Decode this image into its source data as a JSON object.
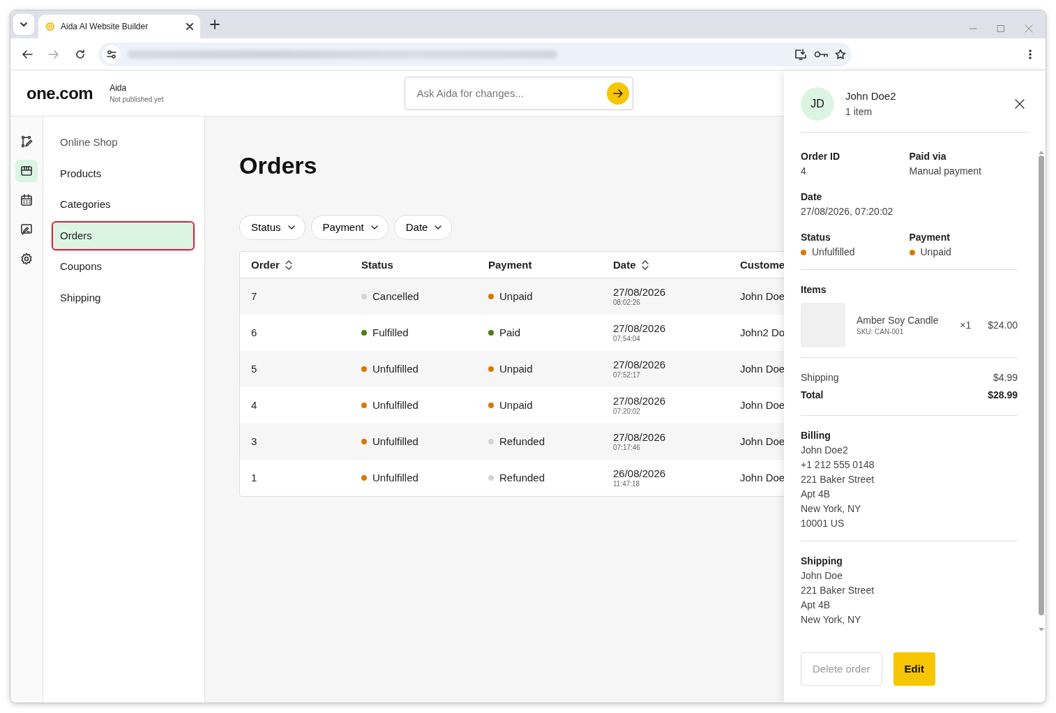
{
  "browser": {
    "tab_title": "Aida AI Website Builder"
  },
  "app": {
    "logo": "one.com",
    "site_name": "Aida",
    "site_status": "Not published yet",
    "ask_placeholder": "Ask Aida for changes..."
  },
  "rail": [
    {
      "selected": false
    },
    {
      "selected": true
    },
    {
      "selected": false
    },
    {
      "selected": false
    },
    {
      "selected": false
    }
  ],
  "sidebar": {
    "heading": "Online Shop",
    "items": [
      {
        "label": "Products",
        "selected": false
      },
      {
        "label": "Categories",
        "selected": false
      },
      {
        "label": "Orders",
        "selected": true
      },
      {
        "label": "Coupons",
        "selected": false
      },
      {
        "label": "Shipping",
        "selected": false
      }
    ]
  },
  "page_title": "Orders",
  "filters": [
    "Status",
    "Payment",
    "Date"
  ],
  "table": {
    "columns": [
      {
        "label": "Order",
        "sortable": true
      },
      {
        "label": "Status",
        "sortable": false
      },
      {
        "label": "Payment",
        "sortable": false
      },
      {
        "label": "Date",
        "sortable": true
      },
      {
        "label": "Custome",
        "sortable": false
      }
    ],
    "rows": [
      {
        "order": "7",
        "status": {
          "text": "Cancelled",
          "color": "#d4d4d4"
        },
        "payment": {
          "text": "Unpaid",
          "color": "#d97706"
        },
        "date": "27/08/2026",
        "time": "08:02:26",
        "customer": "John Doe"
      },
      {
        "order": "6",
        "status": {
          "text": "Fulfilled",
          "color": "#4d7c0f"
        },
        "payment": {
          "text": "Paid",
          "color": "#4d7c0f"
        },
        "date": "27/08/2026",
        "time": "07:54:04",
        "customer": "John2 Do"
      },
      {
        "order": "5",
        "status": {
          "text": "Unfulfilled",
          "color": "#d97706"
        },
        "payment": {
          "text": "Unpaid",
          "color": "#d97706"
        },
        "date": "27/08/2026",
        "time": "07:52:17",
        "customer": "John Doe"
      },
      {
        "order": "4",
        "status": {
          "text": "Unfulfilled",
          "color": "#d97706"
        },
        "payment": {
          "text": "Unpaid",
          "color": "#d97706"
        },
        "date": "27/08/2026",
        "time": "07:20:02",
        "customer": "John Doe"
      },
      {
        "order": "3",
        "status": {
          "text": "Unfulfilled",
          "color": "#d97706"
        },
        "payment": {
          "text": "Refunded",
          "color": "#d4d4d4"
        },
        "date": "27/08/2026",
        "time": "07:17:46",
        "customer": "John Doe"
      },
      {
        "order": "1",
        "status": {
          "text": "Unfulfilled",
          "color": "#d97706"
        },
        "payment": {
          "text": "Refunded",
          "color": "#d4d4d4"
        },
        "date": "26/08/2026",
        "time": "11:47:18",
        "customer": "John Doe"
      }
    ]
  },
  "drawer": {
    "avatar": "JD",
    "customer": "John Doe2",
    "item_count": "1 item",
    "fields": [
      {
        "label": "Order ID",
        "value": "4",
        "wide": false
      },
      {
        "label": "Paid via",
        "value": "Manual payment",
        "wide": false
      },
      {
        "label": "Date",
        "value": "27/08/2026, 07:20:02",
        "wide": true
      }
    ],
    "states": [
      {
        "label": "Status",
        "value": "Unfulfilled",
        "color": "#d97706"
      },
      {
        "label": "Payment",
        "value": "Unpaid",
        "color": "#d97706"
      }
    ],
    "items_title": "Items",
    "items": [
      {
        "name": "Amber Soy Candle",
        "sku": "SKU: CAN-001",
        "qty": "×1",
        "price": "$24.00"
      }
    ],
    "totals": [
      {
        "label": "Shipping",
        "value": "$4.99",
        "strong": false
      },
      {
        "label": "Total",
        "value": "$28.99",
        "strong": true
      }
    ],
    "addresses": [
      {
        "title": "Billing",
        "lines": [
          "John Doe2",
          "+1 212 555 0148",
          "221 Baker Street",
          "Apt 4B",
          "New York, NY",
          "10001 US"
        ]
      },
      {
        "title": "Shipping",
        "lines": [
          "John Doe",
          "221 Baker Street",
          "Apt 4B",
          "New York, NY"
        ]
      }
    ],
    "delete_label": "Delete order",
    "edit_label": "Edit"
  }
}
